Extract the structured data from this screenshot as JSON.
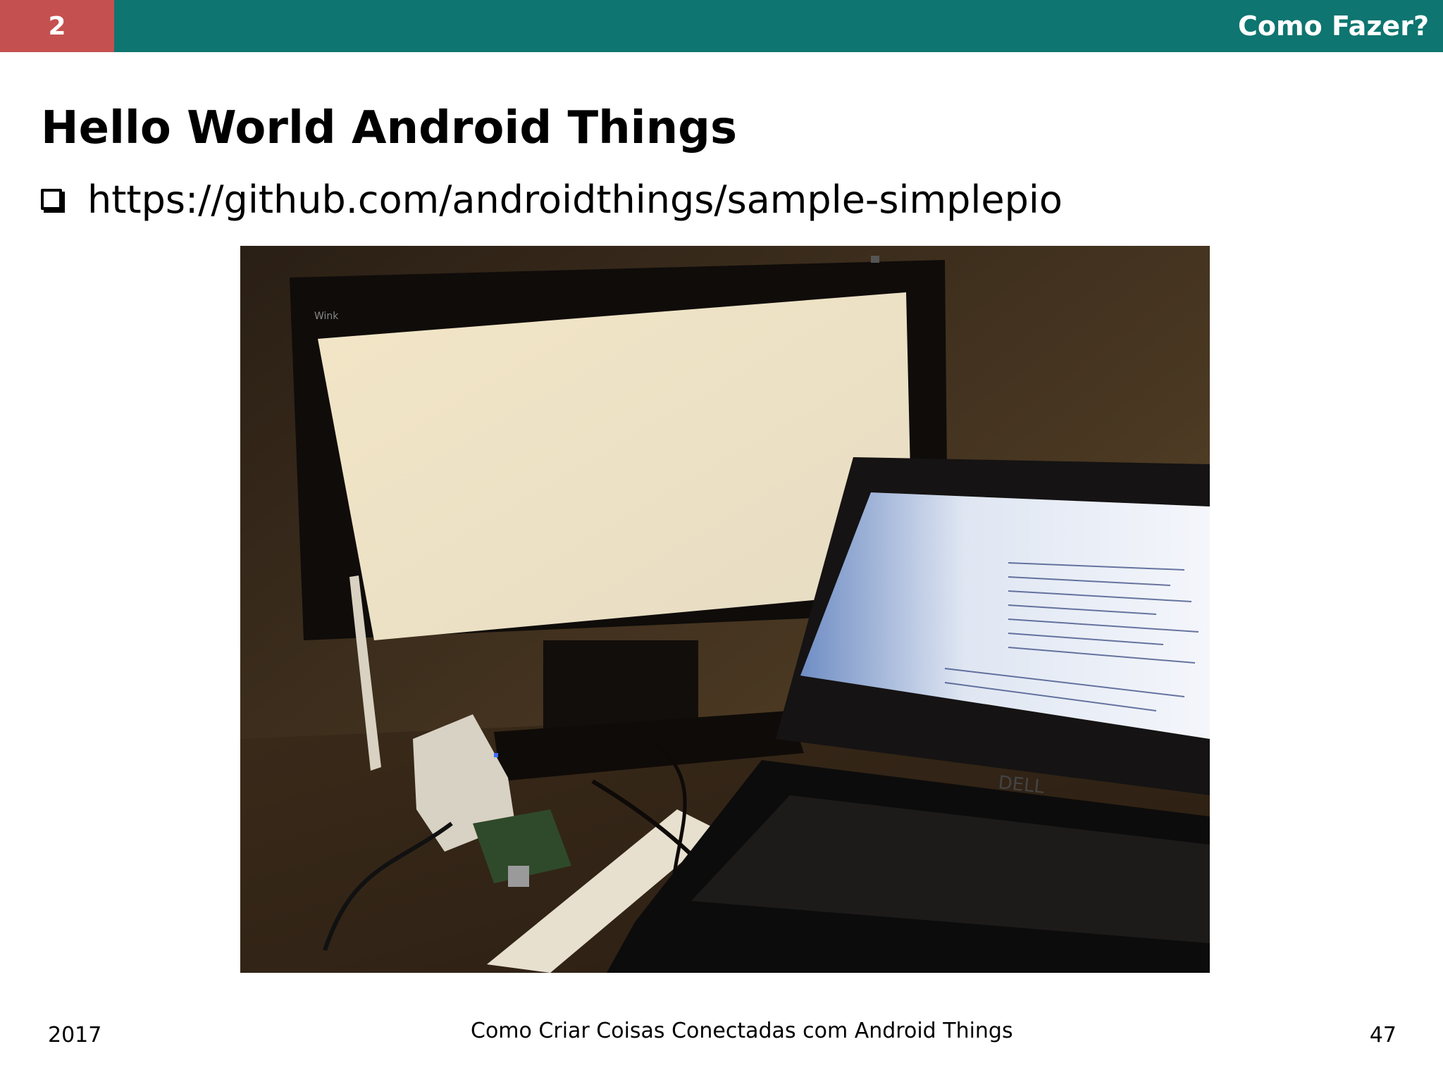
{
  "header": {
    "section_number": "2",
    "section_title": "Como Fazer?",
    "colors": {
      "bar": "#0e7570",
      "number_box": "#c55050"
    }
  },
  "slide": {
    "title": "Hello World Android Things",
    "bullets": [
      {
        "icon": "checkbox-icon",
        "text": "https://github.com/androidthings/sample-simplepio"
      }
    ]
  },
  "photo": {
    "alt": "Monitor, laptop, Raspberry Pi and breadboard setup",
    "monitor_screen_text": "Wink",
    "laptop_brand": "DELL"
  },
  "footer": {
    "year": "2017",
    "center_text": "Como Criar Coisas Conectadas com Android Things",
    "page_number": "47"
  }
}
